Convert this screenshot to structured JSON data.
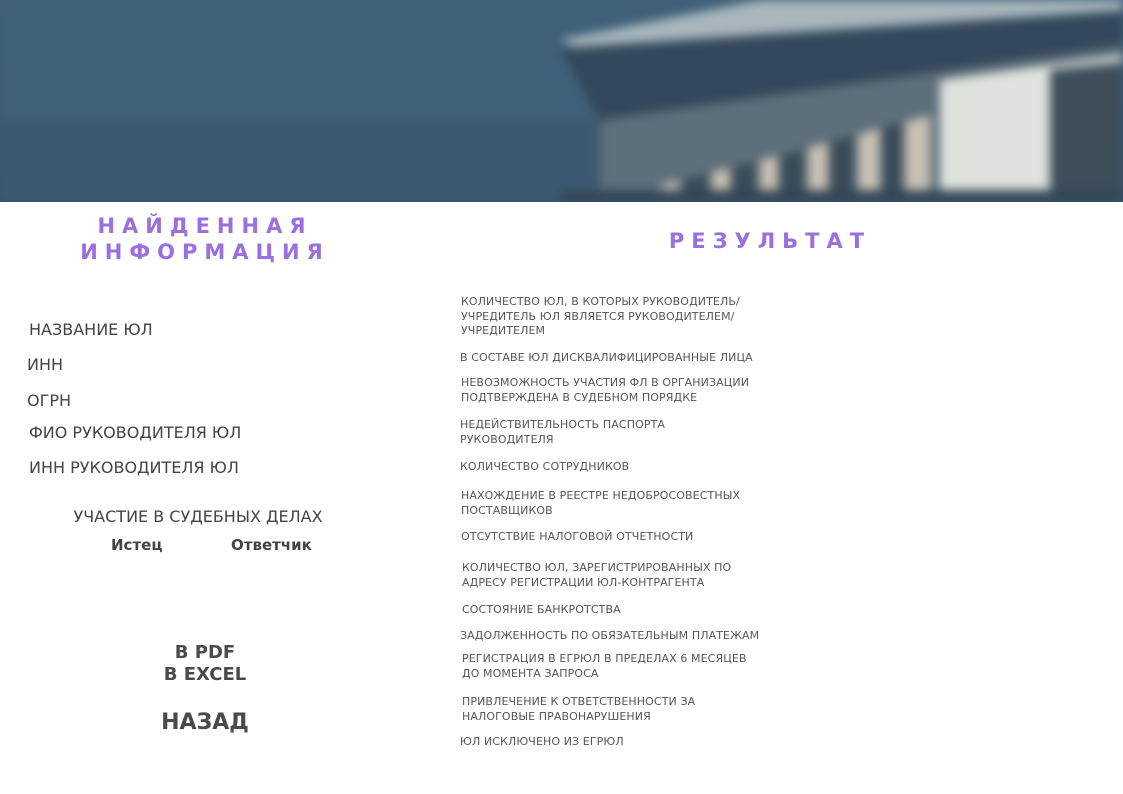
{
  "hero": {
    "colors": {
      "sky": "#3f6079",
      "building": "#dfe4e0",
      "shadow": "#2f4457",
      "fins": "#c8c1b8"
    }
  },
  "found": {
    "title_line1": "НАЙДЕННАЯ",
    "title_line2": "ИНФОРМАЦИЯ",
    "fields": {
      "company_name": "НАЗВАНИЕ ЮЛ",
      "inn": "ИНН",
      "ogrn": "ОГРН",
      "head_name": "ФИО РУКОВОДИТЕЛЯ ЮЛ",
      "head_inn": "ИНН РУКОВОДИТЕЛЯ ЮЛ"
    },
    "court": {
      "title": "УЧАСТИЕ В СУДЕБНЫХ ДЕЛАХ",
      "plaintiff": "Истец",
      "defendant": "Ответчик"
    }
  },
  "actions": {
    "pdf": "В PDF",
    "excel": "В EXCEL",
    "back": "НАЗАД"
  },
  "result": {
    "title": "РЕЗУЛЬТАТ",
    "items": [
      [
        "КОЛИЧЕСТВО ЮЛ, В КОТОРЫХ РУКОВОДИТЕЛЬ/",
        "УЧРЕДИТЕЛЬ ЮЛ ЯВЛЯЕТСЯ РУКОВОДИТЕЛЕМ/",
        "УЧРЕДИТЕЛЕМ"
      ],
      [
        "В СОСТАВЕ ЮЛ ДИСКВАЛИФИЦИРОВАННЫЕ ЛИЦА"
      ],
      [
        "НЕВОЗМОЖНОСТЬ УЧАСТИЯ ФЛ В ОРГАНИЗАЦИИ",
        "ПОДТВЕРЖДЕНА В СУДЕБНОМ ПОРЯДКЕ"
      ],
      [
        "НЕДЕЙСТВИТЕЛЬНОСТЬ ПАСПОРТА",
        "РУКОВОДИТЕЛЯ"
      ],
      [
        "КОЛИЧЕСТВО СОТРУДНИКОВ"
      ],
      [
        "НАХОЖДЕНИЕ В РЕЕСТРЕ НЕДОБРОСОВЕСТНЫХ",
        "ПОСТАВЩИКОВ"
      ],
      [
        "ОТСУТСТВИЕ НАЛОГОВОЙ ОТЧЕТНОСТИ"
      ],
      [
        "КОЛИЧЕСТВО ЮЛ, ЗАРЕГИСТРИРОВАННЫХ ПО",
        "АДРЕСУ РЕГИСТРАЦИИ ЮЛ-КОНТРАГЕНТА"
      ],
      [
        "СОСТОЯНИЕ БАНКРОТСТВА"
      ],
      [
        "ЗАДОЛЖЕННОСТЬ ПО ОБЯЗАТЕЛЬНЫМ ПЛАТЕЖАМ"
      ],
      [
        "РЕГИСТРАЦИЯ В ЕГРЮЛ В ПРЕДЕЛАХ 6 МЕСЯЦЕВ",
        "ДО МОМЕНТА ЗАПРОСА"
      ],
      [
        "ПРИВЛЕЧЕНИЕ К ОТВЕТСТВЕННОСТИ ЗА",
        "НАЛОГОВЫЕ ПРАВОНАРУШЕНИЯ"
      ],
      [
        "ЮЛ ИСКЛЮЧЕНО ИЗ ЕГРЮЛ"
      ]
    ]
  },
  "colors": {
    "accent": "#9b6fe0",
    "text": "#444444"
  }
}
